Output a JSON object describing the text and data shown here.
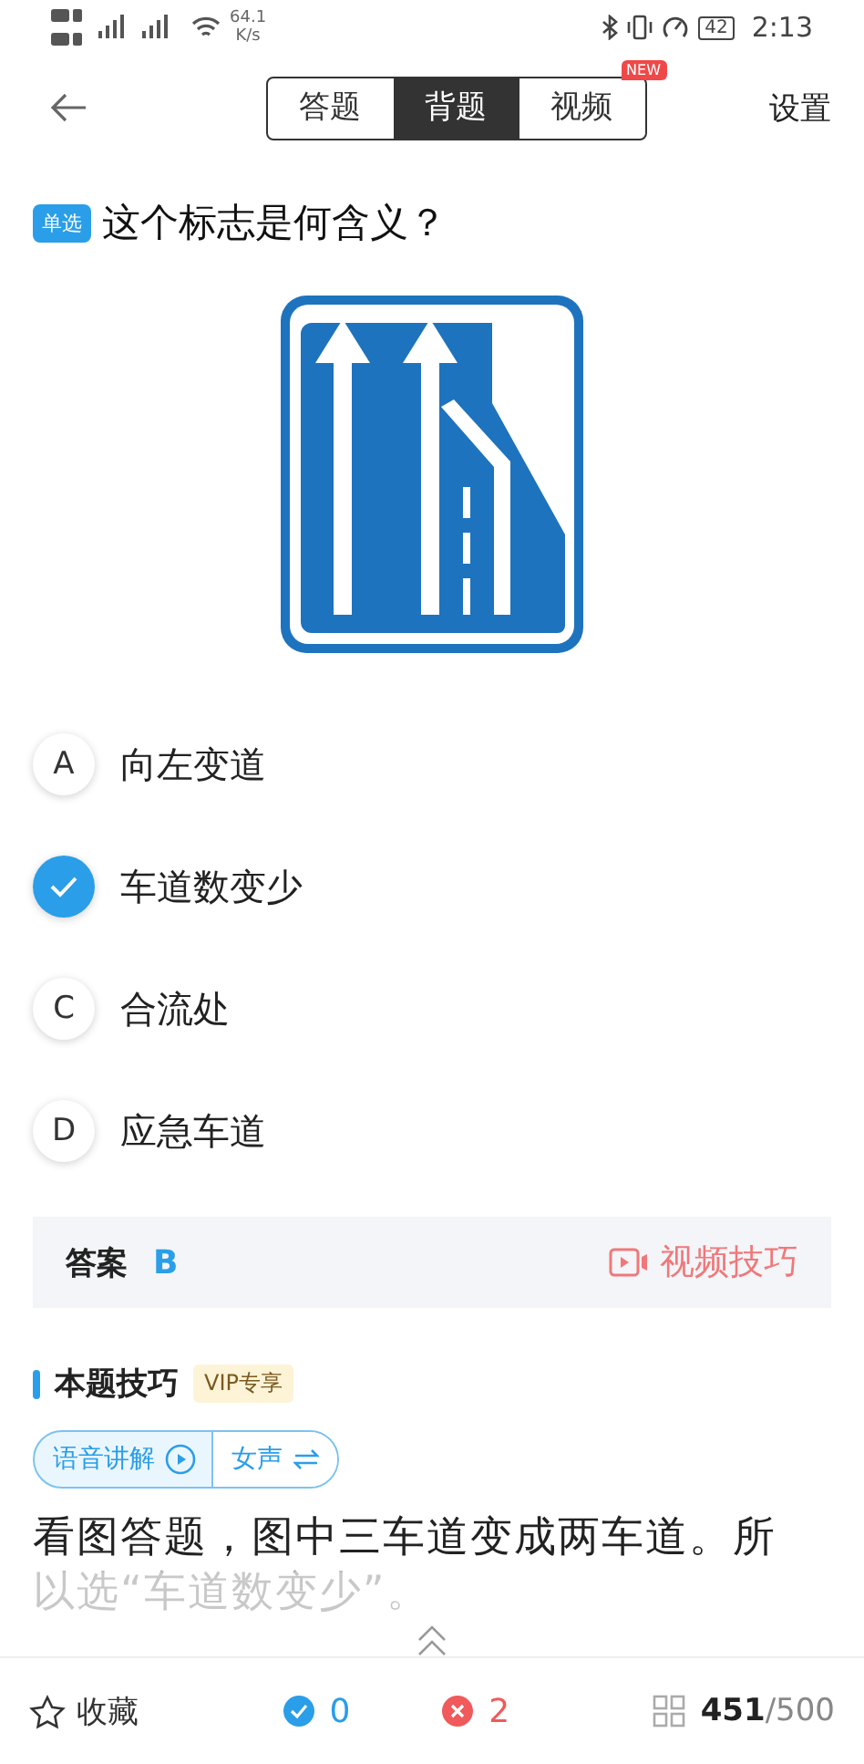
{
  "status_bar": {
    "speed": "64.1",
    "speed_unit": "K/s",
    "battery": "42",
    "time": "2:13"
  },
  "nav": {
    "tabs": [
      {
        "label": "答题",
        "selected": false
      },
      {
        "label": "背题",
        "selected": true
      },
      {
        "label": "视频",
        "selected": false,
        "badge": "NEW"
      }
    ],
    "settings": "设置"
  },
  "question": {
    "type_tag": "单选",
    "text": "这个标志是何含义？"
  },
  "options": [
    {
      "letter": "A",
      "text": "向左变道",
      "selected": false
    },
    {
      "text": "车道数变少",
      "selected": true
    },
    {
      "letter": "C",
      "text": "合流处",
      "selected": false
    },
    {
      "letter": "D",
      "text": "应急车道",
      "selected": false
    }
  ],
  "answer": {
    "label": "答案",
    "value": "B",
    "video_tip": "视频技巧"
  },
  "tips": {
    "title": "本题技巧",
    "vip": "VIP专享",
    "voice": "语音讲解",
    "gender": "女声",
    "explanation": "看图答题，图中三车道变成两车道。所以选“车道数变少”。"
  },
  "bottom_bar": {
    "favorite": "收藏",
    "correct": "0",
    "wrong": "2",
    "current": "451",
    "total": "/500"
  }
}
